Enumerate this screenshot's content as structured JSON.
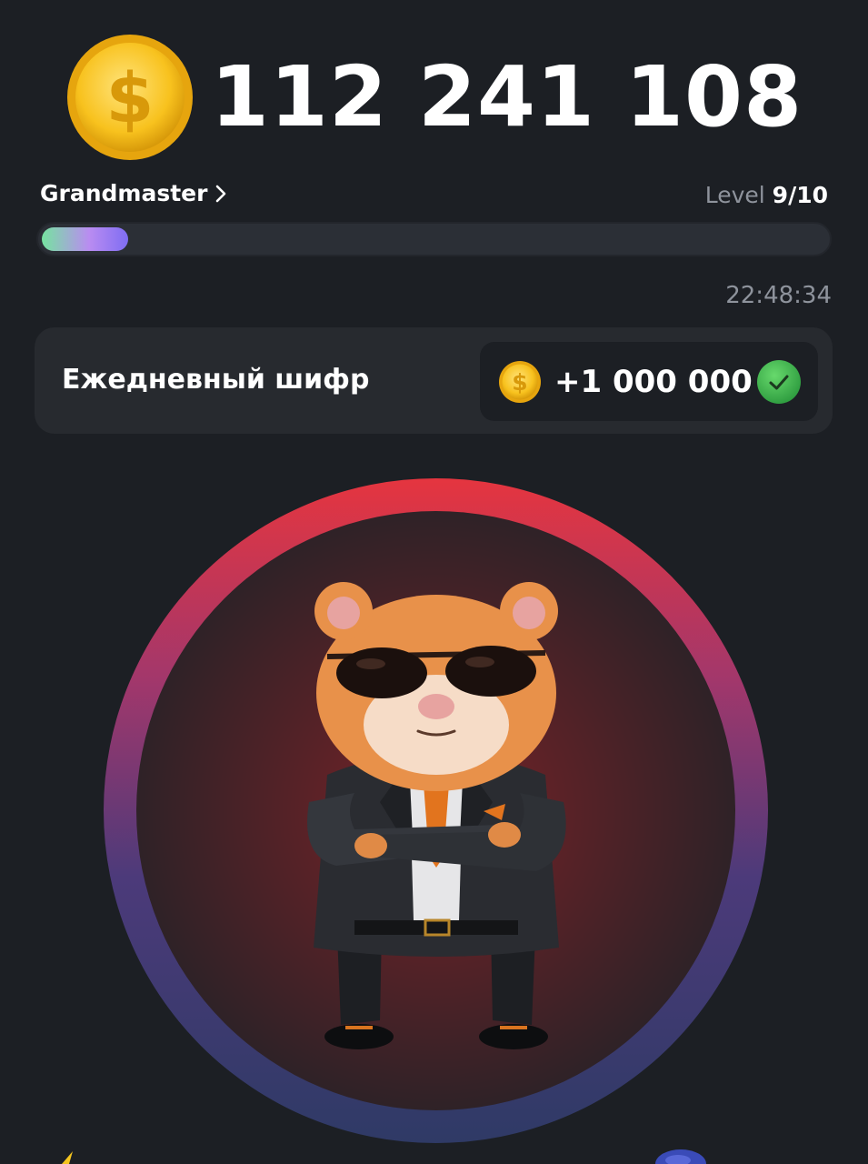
{
  "balance": {
    "coin_icon": "dollar-coin-icon",
    "value": "112 241 108"
  },
  "level": {
    "rank_name": "Grandmaster",
    "label": "Level",
    "value": "9/10",
    "progress_fraction": 0.11
  },
  "timer": "22:48:34",
  "daily_cipher": {
    "title": "Ежедневный шифр",
    "reward": "+1 000 000",
    "status_icon": "check-icon"
  },
  "tap_area": {
    "character": "hamster-ceo"
  },
  "colors": {
    "background": "#1c1f24",
    "card": "#272a2f",
    "coin": "#f7c92c",
    "check": "#3fb34f",
    "ring_top": "#e5353f",
    "ring_bottom": "#2f3a66"
  }
}
